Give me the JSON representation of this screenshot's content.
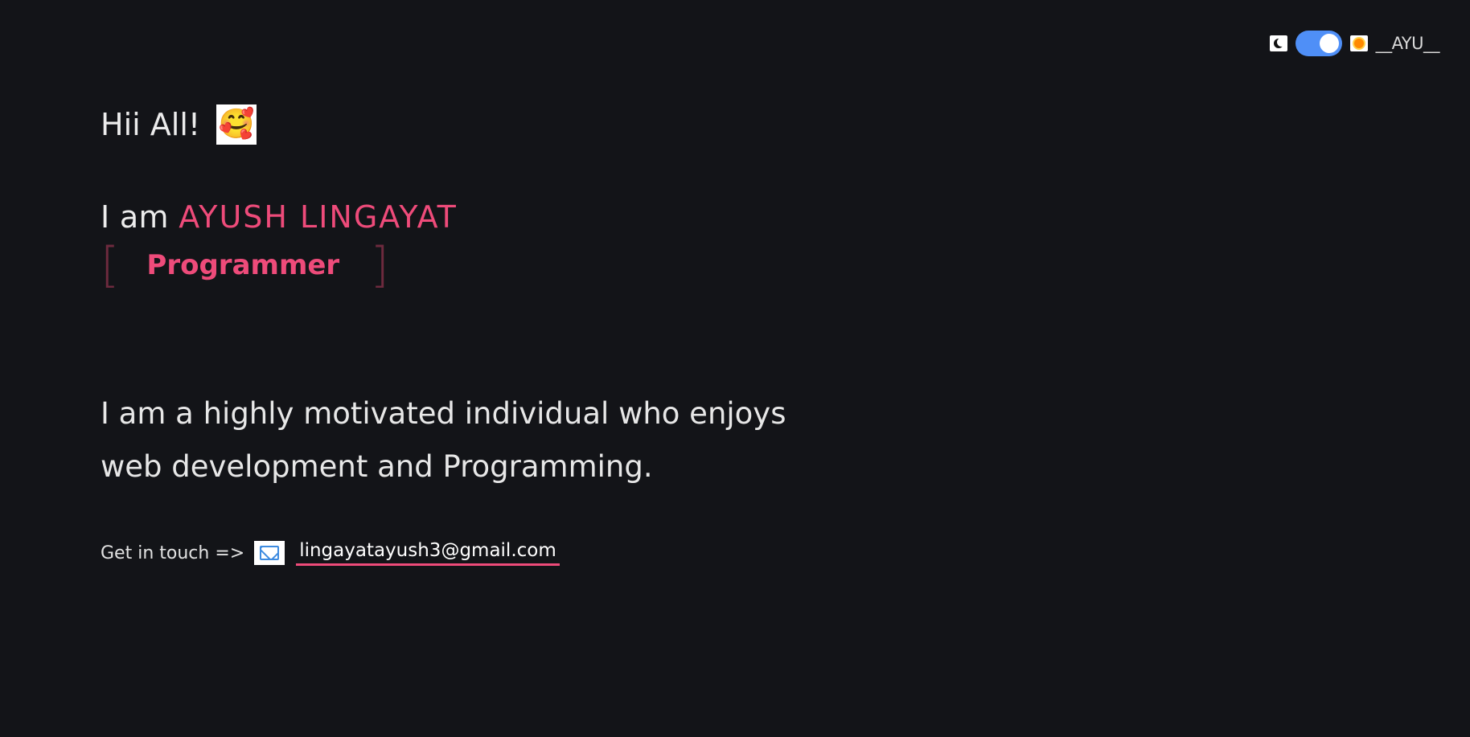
{
  "header": {
    "brand": "__AYU__",
    "moon_icon": "moon-icon",
    "sun_icon": "sun-icon",
    "toggle_state": "on"
  },
  "hero": {
    "greeting": "Hii All!",
    "greeting_emoji": "🥰",
    "intro_prefix": "I am",
    "name": "AYUSH LINGAYAT",
    "bracket_open": "[",
    "role": "Programmer",
    "bracket_close": "]",
    "bio": "I am a highly motivated individual who enjoys web development and Programming.",
    "contact_label": "Get in touch =>",
    "email": "lingayatayush3@gmail.com"
  },
  "colors": {
    "background": "#131418",
    "accent": "#ee4b7a",
    "toggle": "#4f8ff7",
    "bracket": "#6d2a3e"
  }
}
